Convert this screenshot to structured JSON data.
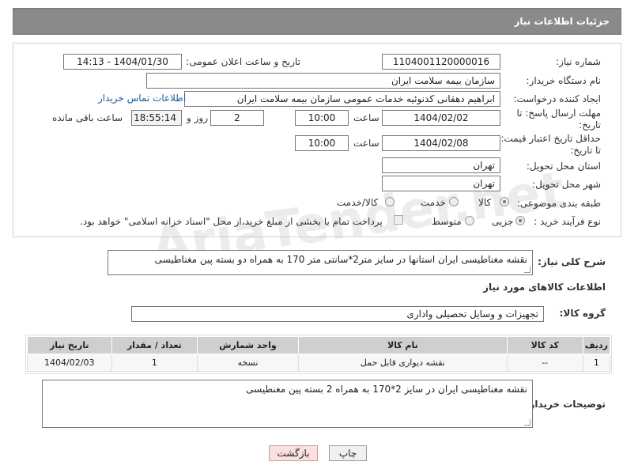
{
  "header": {
    "title": "جزئیات اطلاعات نیاز"
  },
  "fields": {
    "need_number_label": "شماره نیاز:",
    "need_number": "1104001120000016",
    "announce_label": "تاریخ و ساعت اعلان عمومی:",
    "announce_value": "1404/01/30 - 14:13",
    "buyer_org_label": "نام دستگاه خریدار:",
    "buyer_org": "سازمان بیمه سلامت ایران",
    "creator_label": "ایجاد کننده درخواست:",
    "creator": "ابراهیم دهقانی کدنوئیه خدمات عمومی سازمان بیمه سلامت ایران",
    "contact_link": "اطلاعات تماس خریدار",
    "deadline_label_1": "مهلت ارسال پاسخ: تا",
    "deadline_label_2": "تاریخ:",
    "deadline_date": "1404/02/02",
    "time_label": "ساعت",
    "deadline_time": "10:00",
    "days_value": "2",
    "days_label": "روز و",
    "remaining_time": "18:55:14",
    "remaining_label": "ساعت باقی مانده",
    "validity_label_1": "حداقل تاریخ اعتبار قیمت:",
    "validity_label_2": "تا تاریخ:",
    "validity_date": "1404/02/08",
    "validity_time": "10:00",
    "province_label": "استان محل تحویل:",
    "province": "تهران",
    "city_label": "شهر محل تحویل:",
    "city": "تهران",
    "category_label": "طبقه بندی موضوعی:",
    "category_options": [
      "کالا",
      "خدمت",
      "کالا/خدمت"
    ],
    "process_label": "نوع فرآیند خرید :",
    "process_options": [
      "جزیی",
      "متوسط"
    ],
    "payment_note": "پرداخت تمام یا بخشی از مبلغ خرید،از محل \"اسناد خزانه اسلامی\" خواهد بود."
  },
  "description": {
    "label": "شرح کلی نیاز:",
    "text": "نقشه مغناطیسی ایران استانها در سایز متر2*سانتی متر 170 به همراه دو بسته پین مغناطیسی"
  },
  "goods_info": {
    "title": "اطلاعات کالاهای مورد نیاز",
    "group_label": "گروه کالا:",
    "group_value": "تجهیزات و وسایل تحصیلی واداری"
  },
  "table": {
    "headers": [
      "ردیف",
      "کد کالا",
      "نام کالا",
      "واحد شمارش",
      "تعداد / مقدار",
      "تاریخ نیاز"
    ],
    "rows": [
      [
        "1",
        "--",
        "نقشه دیواری قابل حمل",
        "نسخه",
        "1",
        "1404/02/03"
      ]
    ]
  },
  "buyer_notes": {
    "label": "توضیحات خریدار:",
    "text": "نقشه مغناطیسی ایران در سایز 2*170 به همراه 2 بسته پین مغنطیسی"
  },
  "buttons": {
    "print": "چاپ",
    "back": "بازگشت"
  },
  "watermark": "AriaTender.net"
}
